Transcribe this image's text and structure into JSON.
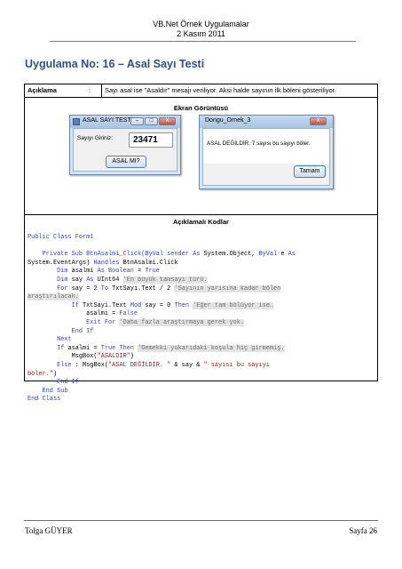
{
  "header": {
    "line1": "VB.Net Örnek Uygulamalar",
    "line2": "2 Kasım 2011"
  },
  "title": "Uygulama No: 16 – Asal Sayı Testi",
  "table": {
    "aciklama_key": "Açıklama",
    "colon": ":",
    "aciklama_value": "Sayı asal ise \"Asaldır\" mesajı veriliyor. Aksi halde sayının ilk böleni gösteriliyor.",
    "screen_title": "Ekran Görüntüsü",
    "code_title": "Açıklamalı Kodlar"
  },
  "window1": {
    "title": "ASAL SAYI TESTİ",
    "label": "Sayıyı Giriniz:",
    "value": "23471",
    "button": "ASAL MI?",
    "min": "–",
    "max": "□",
    "close": "X"
  },
  "window2": {
    "title": "Dongu_Ornek_3",
    "message": "ASAL DEĞİLDİR. 7 sayısı bu sayıyı böler.",
    "button": "Tamam",
    "close": "X"
  },
  "code": {
    "l1": "Public Class Form1",
    "l3a": "    Private Sub BtnAsalmi_Click(ByVal sender ",
    "l3b": "As",
    "l3c": " System.Object, ",
    "l3d": "ByVal",
    "l3e": " e ",
    "l3f": "As",
    "l4a": "System.EventArgs) ",
    "l4b": "Handles",
    "l4c": " BtnAsalmi.Click",
    "l5a": "        Dim",
    "l5b": " asalmi ",
    "l5c": "As Boolean",
    "l5d": " = ",
    "l5e": "True",
    "l6a": "        Dim",
    "l6b": " say ",
    "l6c": "As",
    "l6d": " UInt64 ",
    "l6e": "'En büyük tamsayı türü.",
    "l7a": "        For",
    "l7b": " say = 2 ",
    "l7c": "To",
    "l7d": " TxtSayi.Text / 2 ",
    "l7e": "'Sayının yarısına kadar bölen",
    "l8": "araştırılacak.",
    "l9a": "            If",
    "l9b": " TxtSayi.Text ",
    "l9c": "Mod",
    "l9d": " say = 0 ",
    "l9e": "Then",
    "l9f": " ",
    "l9g": "'Eğer tam bölüyor ise…",
    "l10": "                asalmi = ",
    "l10b": "False",
    "l11a": "                Exit For",
    "l11b": " ",
    "l11c": "'Daha fazla araştırmaya gerek yok.",
    "l12": "            End If",
    "l13": "        Next",
    "l14a": "        If",
    "l14b": " asalmi = ",
    "l14c": "True",
    "l14d": " ",
    "l14e": "Then",
    "l14f": " ",
    "l14g": "'Demekki yukarıdaki koşula hiç girmemiş.",
    "l15a": "            MsgBox(",
    "l15b": "\"ASALDIR\"",
    "l15c": ")",
    "l16a": "        Else",
    "l16b": " : MsgBox(",
    "l16c": "\"ASAL DEĞİLDİR. \"",
    "l16d": " & say & ",
    "l16e": "\" sayısı bu sayıyı",
    "l17a": "böler.\"",
    "l17b": ")",
    "l18": "        End If",
    "l19": "    End Sub",
    "l20": "End Class"
  },
  "footer": {
    "author": "Tolga GÜYER",
    "page": "Sayfa 26"
  }
}
